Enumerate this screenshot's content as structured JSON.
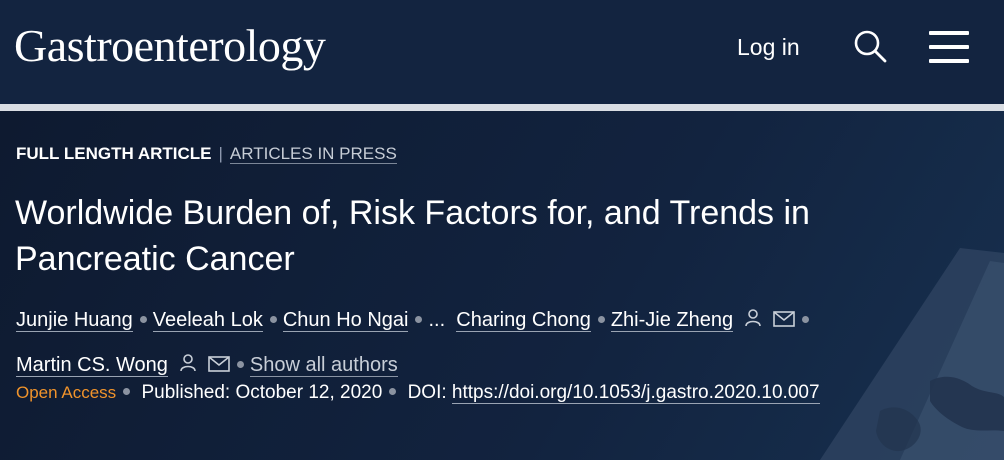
{
  "header": {
    "logo_text": "Gastroenterology",
    "login_label": "Log in",
    "search_icon": "search-icon",
    "menu_icon": "hamburger-menu-icon"
  },
  "article": {
    "type": "FULL LENGTH ARTICLE",
    "section_separator": "|",
    "section": "ARTICLES IN PRESS",
    "title": "Worldwide Burden of, Risk Factors for, and Trends in Pancreatic Cancer",
    "authors": [
      "Junjie Huang",
      "Veeleah Lok",
      "Chun Ho Ngai",
      "Charing Chong",
      "Zhi-Jie Zheng",
      "Martin CS. Wong"
    ],
    "ellipsis": "...",
    "show_all_authors": "Show all authors",
    "open_access": "Open Access",
    "published_label": "Published:",
    "published_date": "October 12, 2020",
    "doi_label": "DOI:",
    "doi": "https://doi.org/10.1053/j.gastro.2020.10.007"
  },
  "colors": {
    "header_bg": "#132440",
    "hero_bg": "#0f1c33",
    "open_access": "#f0932b",
    "divider": "#d9dde3"
  }
}
